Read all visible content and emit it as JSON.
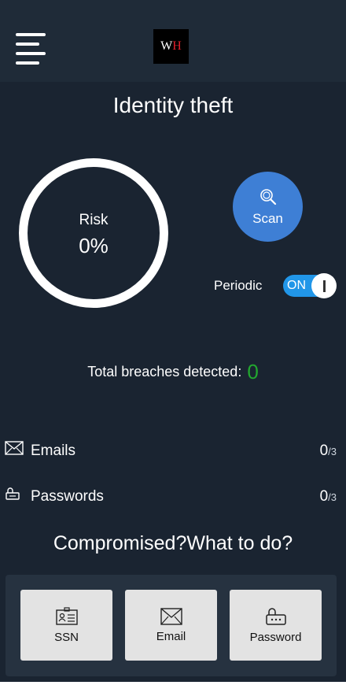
{
  "header": {
    "menu_icon": "hamburger-menu-icon",
    "logo": {
      "left": "W",
      "right": "H"
    }
  },
  "title": "Identity theft",
  "risk": {
    "label": "Risk",
    "value": "0%"
  },
  "scan": {
    "label": "Scan",
    "icon": "search-scan-icon"
  },
  "periodic": {
    "label": "Periodic",
    "toggle_text": "ON",
    "enabled": true
  },
  "breaches": {
    "label": "Total breaches detected:",
    "count": "0"
  },
  "stats": [
    {
      "icon": "envelope-icon",
      "label": "Emails",
      "value": "0",
      "total": "/3"
    },
    {
      "icon": "lock-icon",
      "label": "Passwords",
      "value": "0",
      "total": "/3"
    }
  ],
  "compromised_title": "Compromised?What to do?",
  "actions": [
    {
      "icon": "id-card-icon",
      "label": "SSN"
    },
    {
      "icon": "envelope-icon",
      "label": "Email"
    },
    {
      "icon": "lock-keypad-icon",
      "label": "Password"
    }
  ],
  "colors": {
    "background": "#1a2431",
    "topbar": "#1f2b38",
    "accent_blue": "#3e7fd5",
    "toggle_blue": "#2196e8",
    "success_green": "#22a82f",
    "logo_red": "#e11e2a"
  }
}
